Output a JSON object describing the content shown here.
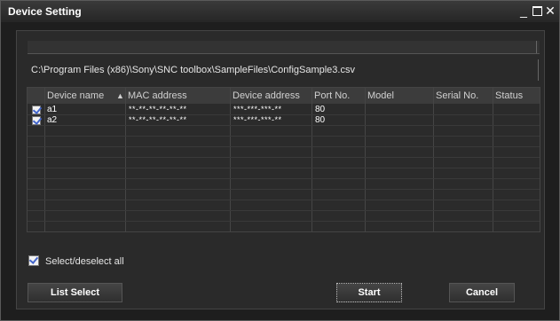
{
  "window": {
    "title": "Device Setting",
    "controls": {
      "minimize": "_",
      "close": "✕"
    }
  },
  "file_path": "C:\\Program Files (x86)\\Sony\\SNC toolbox\\SampleFiles\\ConfigSample3.csv",
  "table": {
    "columns": {
      "device_name": "Device name",
      "sort_indicator": "▲",
      "mac_address": "MAC address",
      "device_address": "Device address",
      "port_no": "Port No.",
      "model": "Model",
      "serial_no": "Serial No.",
      "status": "Status"
    },
    "rows": [
      {
        "checked": true,
        "device_name": "a1",
        "mac_address": "**-**-**-**-**-**",
        "device_address": "***-***-***-**",
        "port_no": "80",
        "model": "",
        "serial_no": "",
        "status": ""
      },
      {
        "checked": true,
        "device_name": "a2",
        "mac_address": "**-**-**-**-**-**",
        "device_address": "***-***-***-**",
        "port_no": "80",
        "model": "",
        "serial_no": "",
        "status": ""
      }
    ]
  },
  "select_all": {
    "label": "Select/deselect all",
    "checked": true
  },
  "buttons": {
    "list_select": "List Select",
    "start": "Start",
    "cancel": "Cancel"
  }
}
